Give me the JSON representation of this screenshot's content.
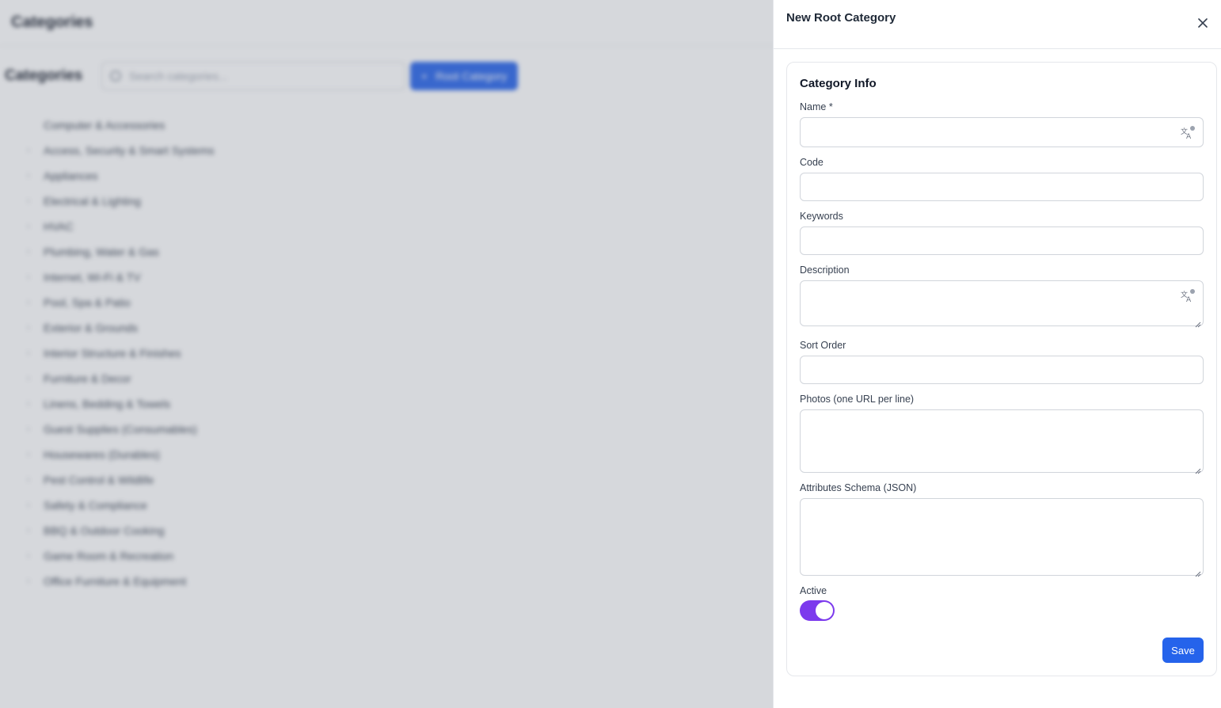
{
  "background": {
    "header_title": "Categories",
    "toolbar_title": "Categories",
    "search_placeholder": "Search categories...",
    "add_button_label": "Root Category",
    "tree": [
      {
        "label": "Computer & Accessories",
        "expandable": false
      },
      {
        "label": "Access, Security & Smart Systems",
        "expandable": true
      },
      {
        "label": "Appliances",
        "expandable": true
      },
      {
        "label": "Electrical & Lighting",
        "expandable": true
      },
      {
        "label": "HVAC",
        "expandable": true
      },
      {
        "label": "Plumbing, Water & Gas",
        "expandable": true
      },
      {
        "label": "Internet, Wi-Fi & TV",
        "expandable": true
      },
      {
        "label": "Pool, Spa & Patio",
        "expandable": true
      },
      {
        "label": "Exterior & Grounds",
        "expandable": true
      },
      {
        "label": "Interior Structure & Finishes",
        "expandable": true
      },
      {
        "label": "Furniture & Decor",
        "expandable": true
      },
      {
        "label": "Linens, Bedding & Towels",
        "expandable": true
      },
      {
        "label": "Guest Supplies (Consumables)",
        "expandable": true
      },
      {
        "label": "Housewares (Durables)",
        "expandable": true
      },
      {
        "label": "Pest Control & Wildlife",
        "expandable": true
      },
      {
        "label": "Safety & Compliance",
        "expandable": true
      },
      {
        "label": "BBQ & Outdoor Cooking",
        "expandable": true
      },
      {
        "label": "Game Room & Recreation",
        "expandable": true
      },
      {
        "label": "Office Furniture & Equipment",
        "expandable": true
      }
    ]
  },
  "drawer": {
    "title": "New Root Category",
    "card_title": "Category Info",
    "fields": {
      "name": {
        "label": "Name *",
        "value": ""
      },
      "code": {
        "label": "Code",
        "value": ""
      },
      "keywords": {
        "label": "Keywords",
        "value": ""
      },
      "description": {
        "label": "Description",
        "value": ""
      },
      "sort_order": {
        "label": "Sort Order",
        "value": ""
      },
      "photos": {
        "label": "Photos (one URL per line)",
        "value": ""
      },
      "attributes_schema": {
        "label": "Attributes Schema (JSON)",
        "value": ""
      }
    },
    "active_label": "Active",
    "active_on": true,
    "save_label": "Save"
  },
  "colors": {
    "primary": "#2563eb",
    "toggle_on": "#7c3aed",
    "border": "#d1d5db"
  }
}
